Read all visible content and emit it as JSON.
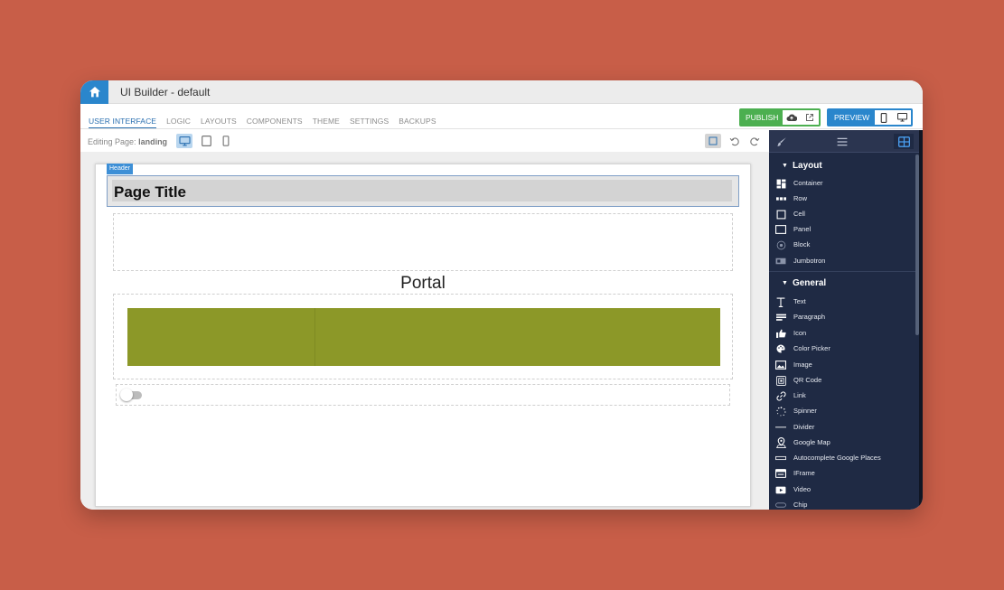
{
  "app": {
    "title": "UI Builder - default"
  },
  "nav": {
    "tabs": [
      {
        "label": "USER INTERFACE"
      },
      {
        "label": "LOGIC"
      },
      {
        "label": "LAYOUTS"
      },
      {
        "label": "COMPONENTS"
      },
      {
        "label": "THEME"
      },
      {
        "label": "SETTINGS"
      },
      {
        "label": "BACKUPS"
      }
    ],
    "publish_label": "PUBLISH",
    "preview_label": "PREVIEW"
  },
  "toolbar": {
    "editing_prefix": "Editing Page:",
    "page_name": "landing"
  },
  "canvas": {
    "header_tag": "Header",
    "page_title": "Page Title",
    "portal_text": "Portal",
    "block_color": "#8c9828"
  },
  "sidebar": {
    "layout_title": "Layout",
    "layout_items": [
      {
        "label": "Container",
        "icon": "container-icon"
      },
      {
        "label": "Row",
        "icon": "row-icon"
      },
      {
        "label": "Cell",
        "icon": "cell-icon"
      },
      {
        "label": "Panel",
        "icon": "panel-icon"
      },
      {
        "label": "Block",
        "icon": "block-icon"
      },
      {
        "label": "Jumbotron",
        "icon": "jumbotron-icon"
      }
    ],
    "general_title": "General",
    "general_items": [
      {
        "label": "Text",
        "icon": "text-icon"
      },
      {
        "label": "Paragraph",
        "icon": "paragraph-icon"
      },
      {
        "label": "Icon",
        "icon": "thumbs-up-icon"
      },
      {
        "label": "Color Picker",
        "icon": "palette-icon"
      },
      {
        "label": "Image",
        "icon": "image-icon"
      },
      {
        "label": "QR Code",
        "icon": "qr-code-icon"
      },
      {
        "label": "Link",
        "icon": "link-icon"
      },
      {
        "label": "Spinner",
        "icon": "spinner-icon"
      },
      {
        "label": "Divider",
        "icon": "divider-icon"
      },
      {
        "label": "Google Map",
        "icon": "map-pin-icon"
      },
      {
        "label": "Autocomplete Google Places",
        "icon": "input-icon"
      },
      {
        "label": "IFrame",
        "icon": "iframe-icon"
      },
      {
        "label": "Video",
        "icon": "video-icon"
      },
      {
        "label": "Chip",
        "icon": "chip-icon"
      }
    ]
  },
  "colors": {
    "accent_blue": "#2a86cc",
    "publish_green": "#4caf50",
    "sidebar_bg": "#1f2a44"
  }
}
